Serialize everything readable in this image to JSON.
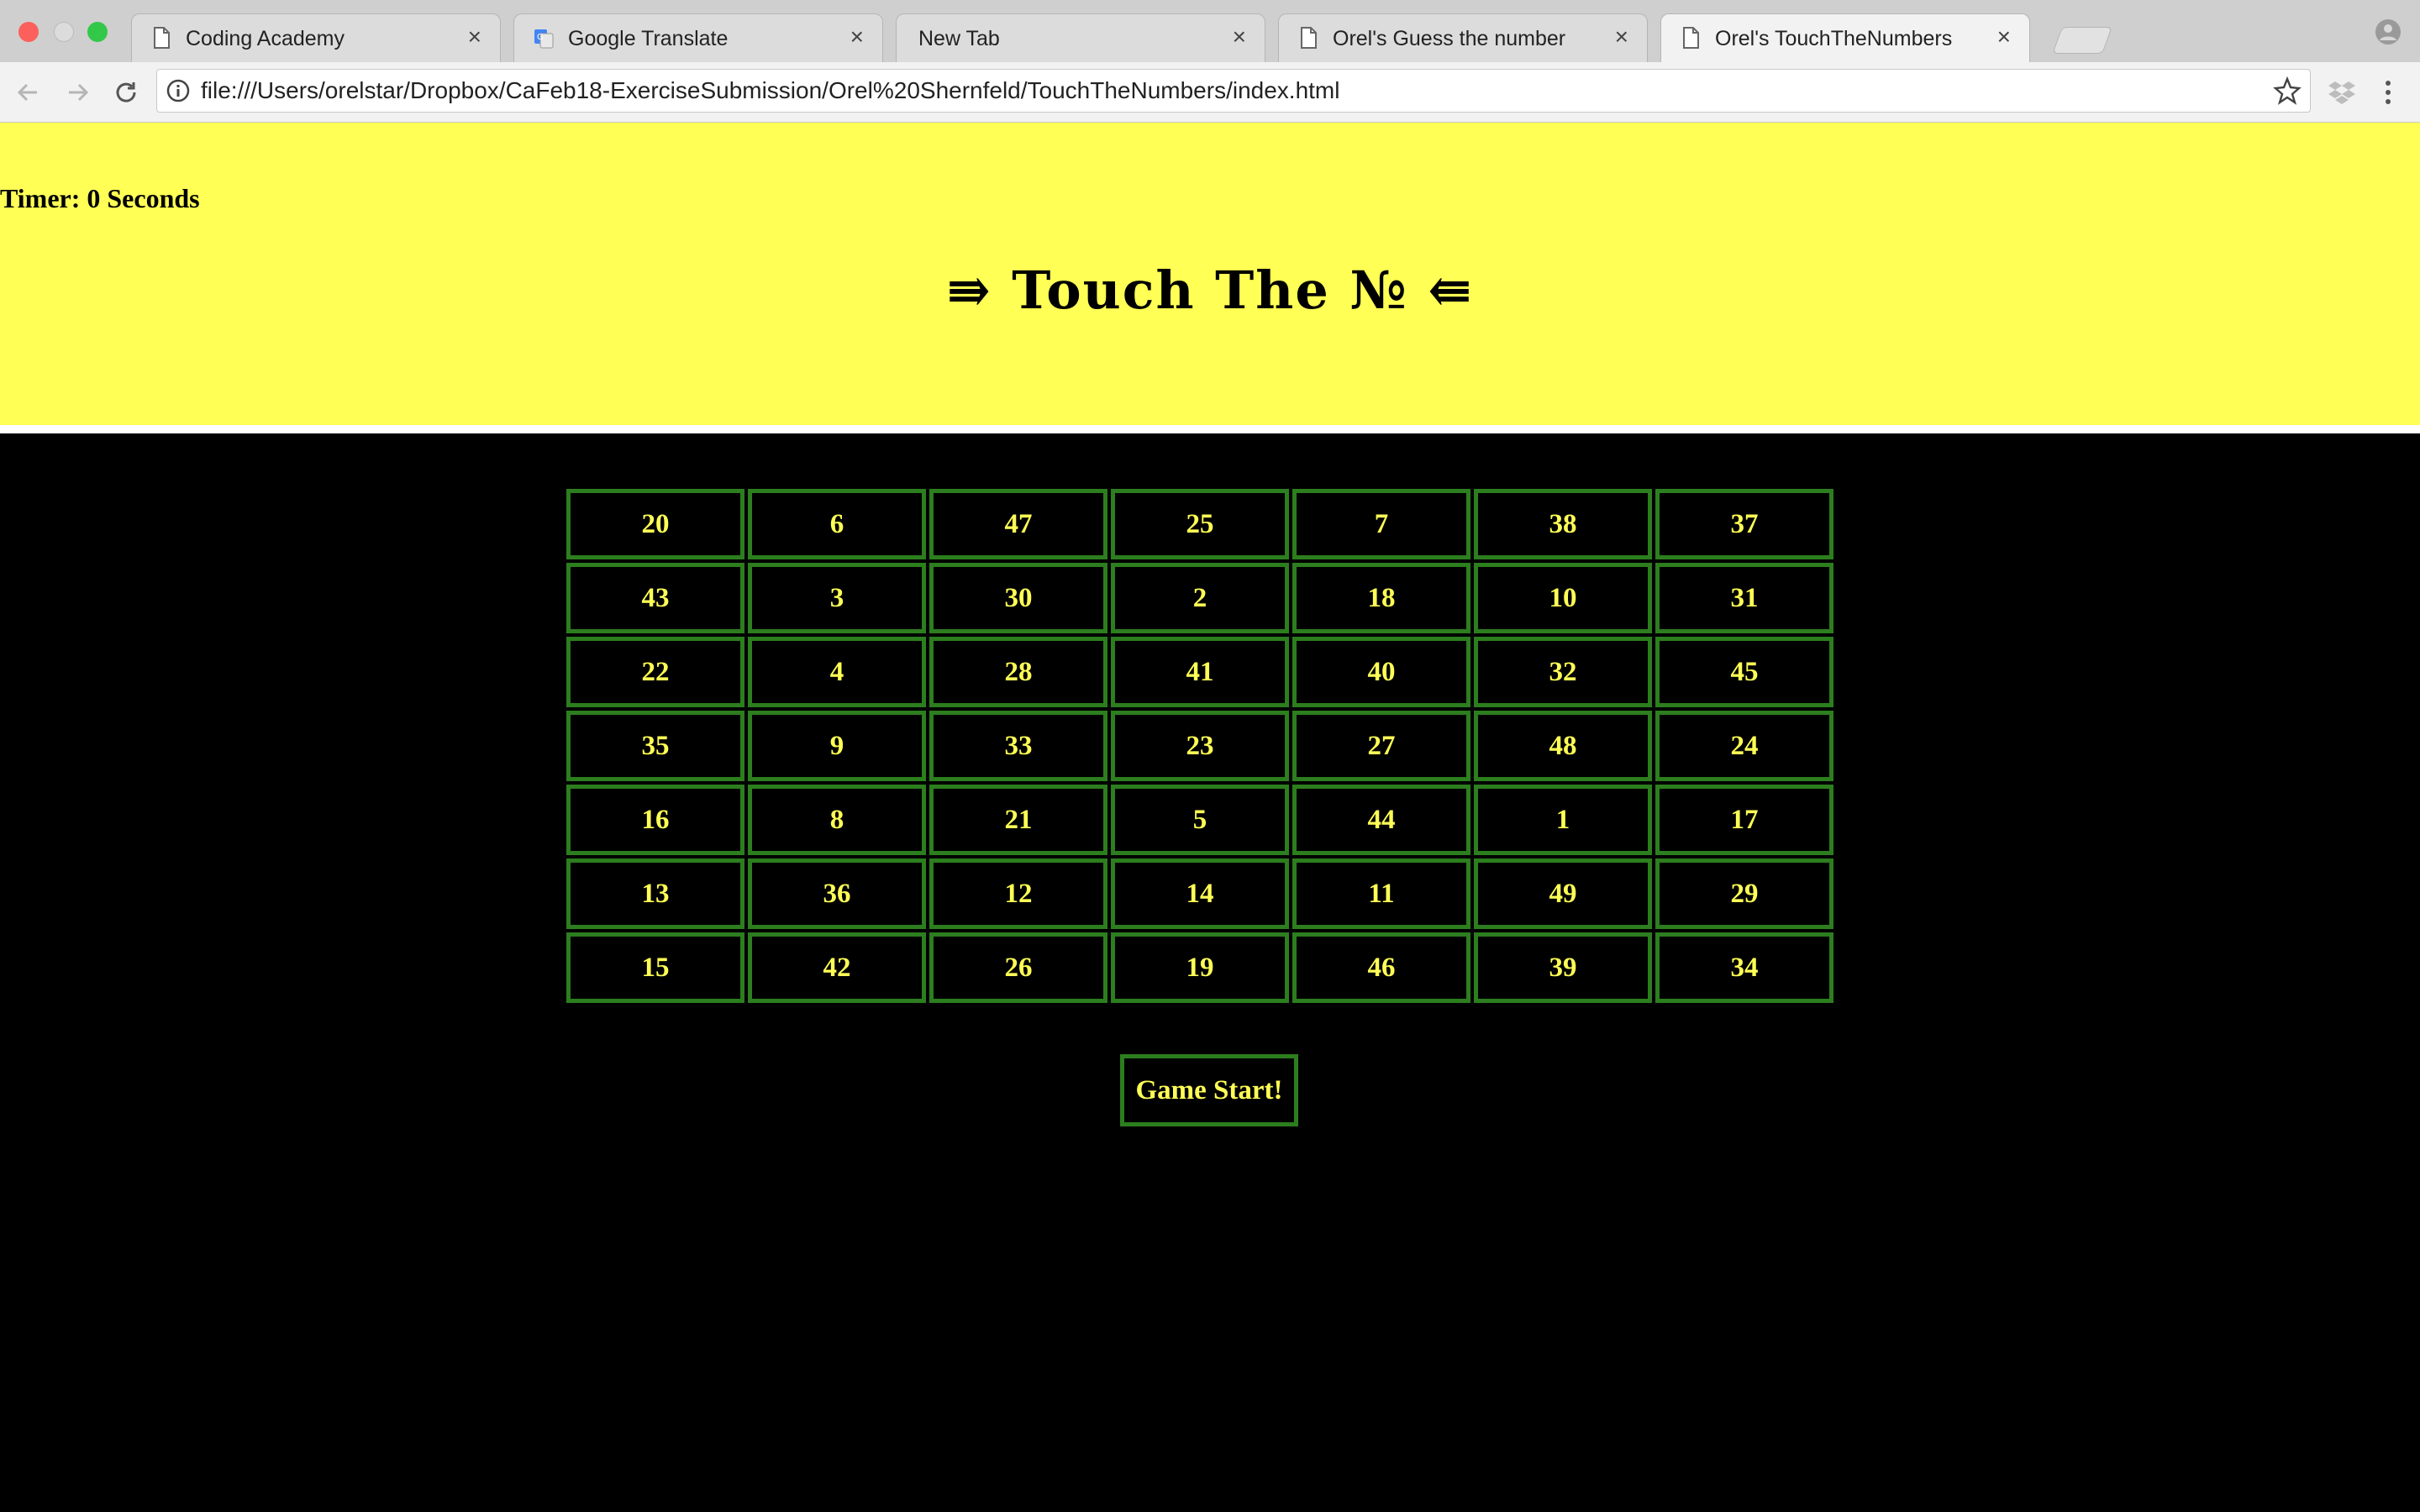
{
  "browser": {
    "tabs": [
      {
        "title": "Coding Academy",
        "icon": "page-icon",
        "active": false
      },
      {
        "title": "Google Translate",
        "icon": "google-translate-icon",
        "active": false
      },
      {
        "title": "New Tab",
        "icon": "",
        "active": false
      },
      {
        "title": "Orel's Guess the number",
        "icon": "page-icon",
        "active": false
      },
      {
        "title": "Orel's TouchTheNumbers",
        "icon": "page-icon",
        "active": true
      }
    ],
    "close_glyph": "×",
    "url": "file:///Users/orelstar/Dropbox/CaFeb18-ExerciseSubmission/Orel%20Shernfeld/TouchTheNumbers/index.html"
  },
  "header": {
    "timer_label": "Timer: 0 Seconds",
    "title": "⇛ Touch The № ⇚",
    "background": "#ffff55"
  },
  "board": {
    "rows": [
      [
        20,
        6,
        47,
        25,
        7,
        38,
        37
      ],
      [
        43,
        3,
        30,
        2,
        18,
        10,
        31
      ],
      [
        22,
        4,
        28,
        41,
        40,
        32,
        45
      ],
      [
        35,
        9,
        33,
        23,
        27,
        48,
        24
      ],
      [
        16,
        8,
        21,
        5,
        44,
        1,
        17
      ],
      [
        13,
        36,
        12,
        14,
        11,
        49,
        29
      ],
      [
        15,
        42,
        26,
        19,
        46,
        39,
        34
      ]
    ],
    "cell_border_color": "#2c7e1e",
    "cell_text_color": "#ffff55"
  },
  "controls": {
    "start_label": "Game Start!"
  }
}
